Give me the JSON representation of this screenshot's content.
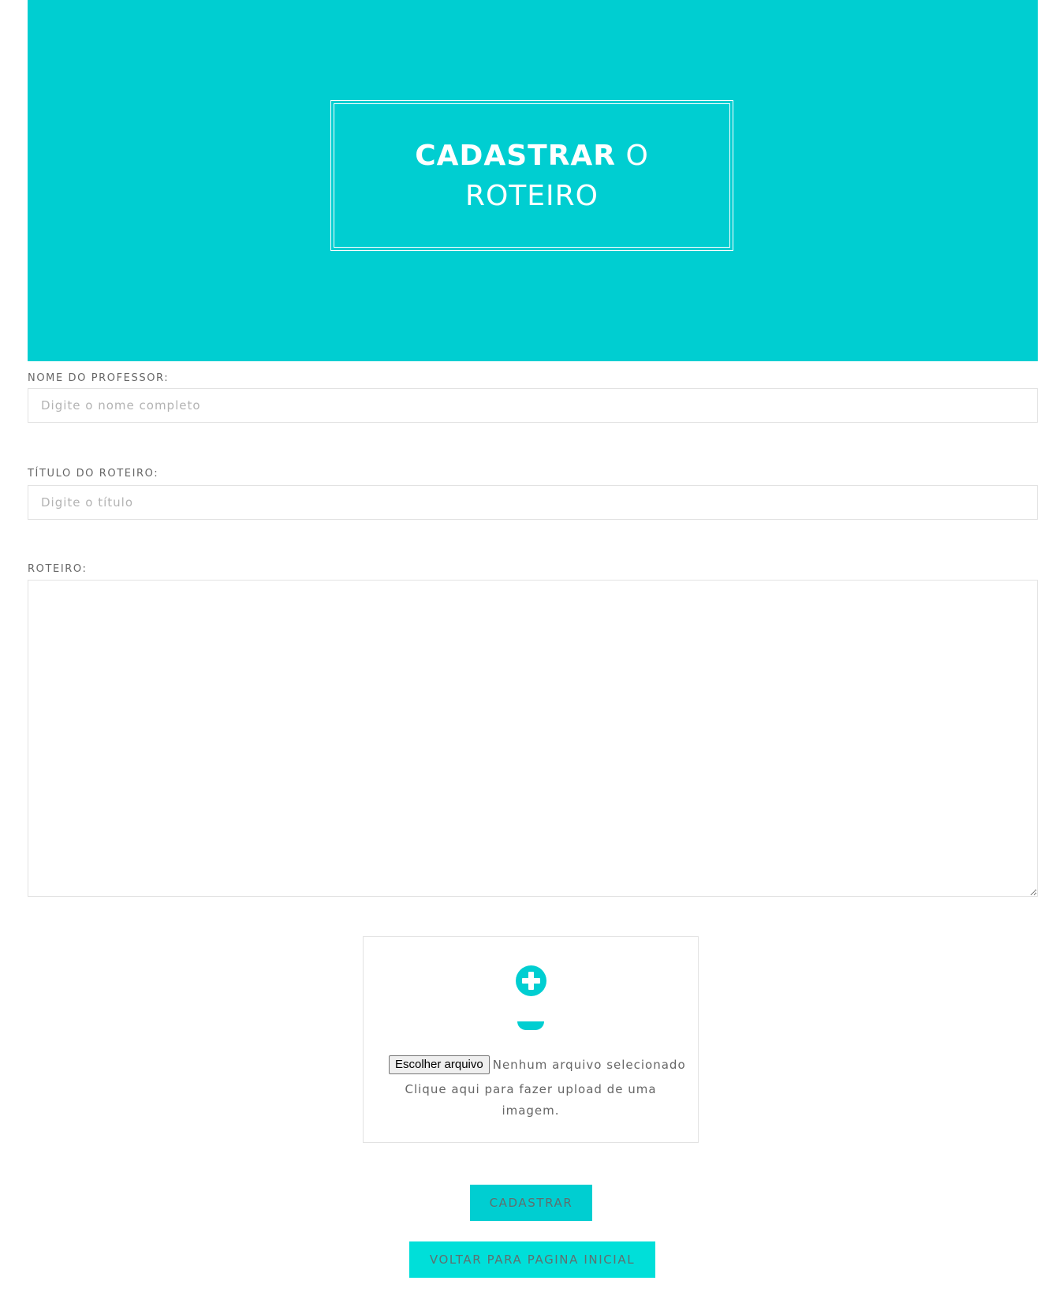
{
  "hero": {
    "title_bold": "CADASTRAR",
    "title_light_1": "O",
    "title_light_2": "ROTEIRO",
    "background_color": "#00ced1"
  },
  "form": {
    "professor": {
      "label": "NOME DO PROFESSOR:",
      "placeholder": "Digite o nome completo",
      "value": ""
    },
    "titulo": {
      "label": "TÍTULO DO ROTEIRO:",
      "placeholder": "Digite o título",
      "value": ""
    },
    "roteiro": {
      "label": "ROTEIRO:",
      "value": ""
    }
  },
  "upload": {
    "plus_icon": "plus-circle-icon",
    "button_label": "Escolher arquivo",
    "status": "Nenhum arquivo selecionado",
    "hint": "Clique aqui para fazer upload de uma imagem."
  },
  "actions": {
    "submit_label": "CADASTRAR",
    "back_label": "VOLTAR PARA PAGINA INICIAL"
  },
  "colors": {
    "accent": "#00ced1",
    "accent_light": "#00dfd9",
    "border": "#e2e2e2"
  }
}
